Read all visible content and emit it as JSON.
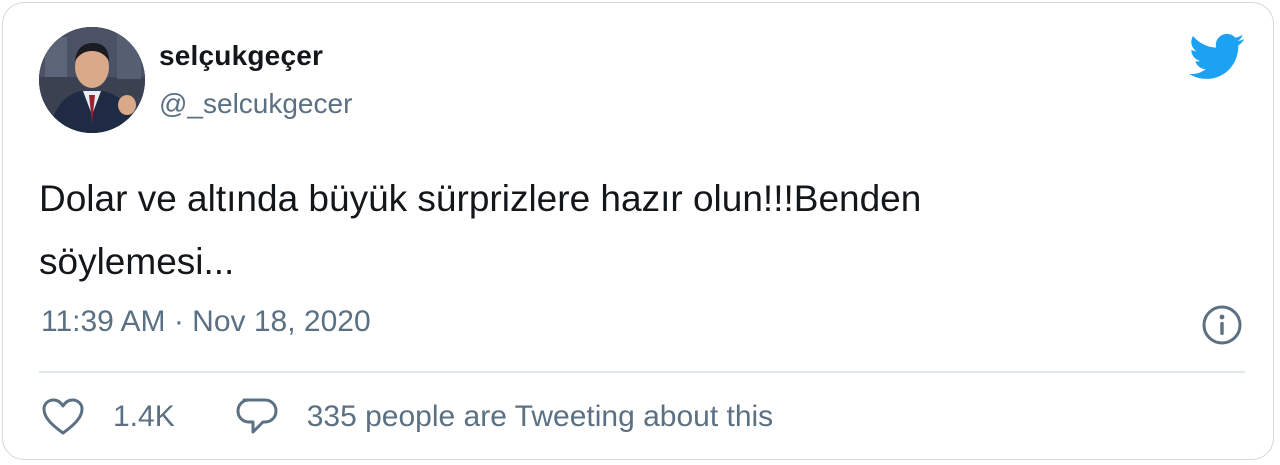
{
  "tweet": {
    "author": {
      "display_name": "selçukgeçer",
      "handle": "@_selcukgecer"
    },
    "text_line1": "Dolar ve altında büyük sürprizlere hazır olun!!!Benden",
    "text_line2": "söylemesi...",
    "timestamp": "11:39 AM · Nov 18, 2020",
    "likes": "1.4K",
    "tweeting_about": "335 people are Tweeting about this"
  },
  "icons": {
    "brand": "twitter-bird-icon",
    "info": "info-icon",
    "like": "heart-icon",
    "reply": "speech-bubble-icon"
  },
  "colors": {
    "brand": "#1da1f2",
    "text_primary": "#14171a",
    "text_secondary": "#5b7083",
    "border": "#cfd9de"
  }
}
